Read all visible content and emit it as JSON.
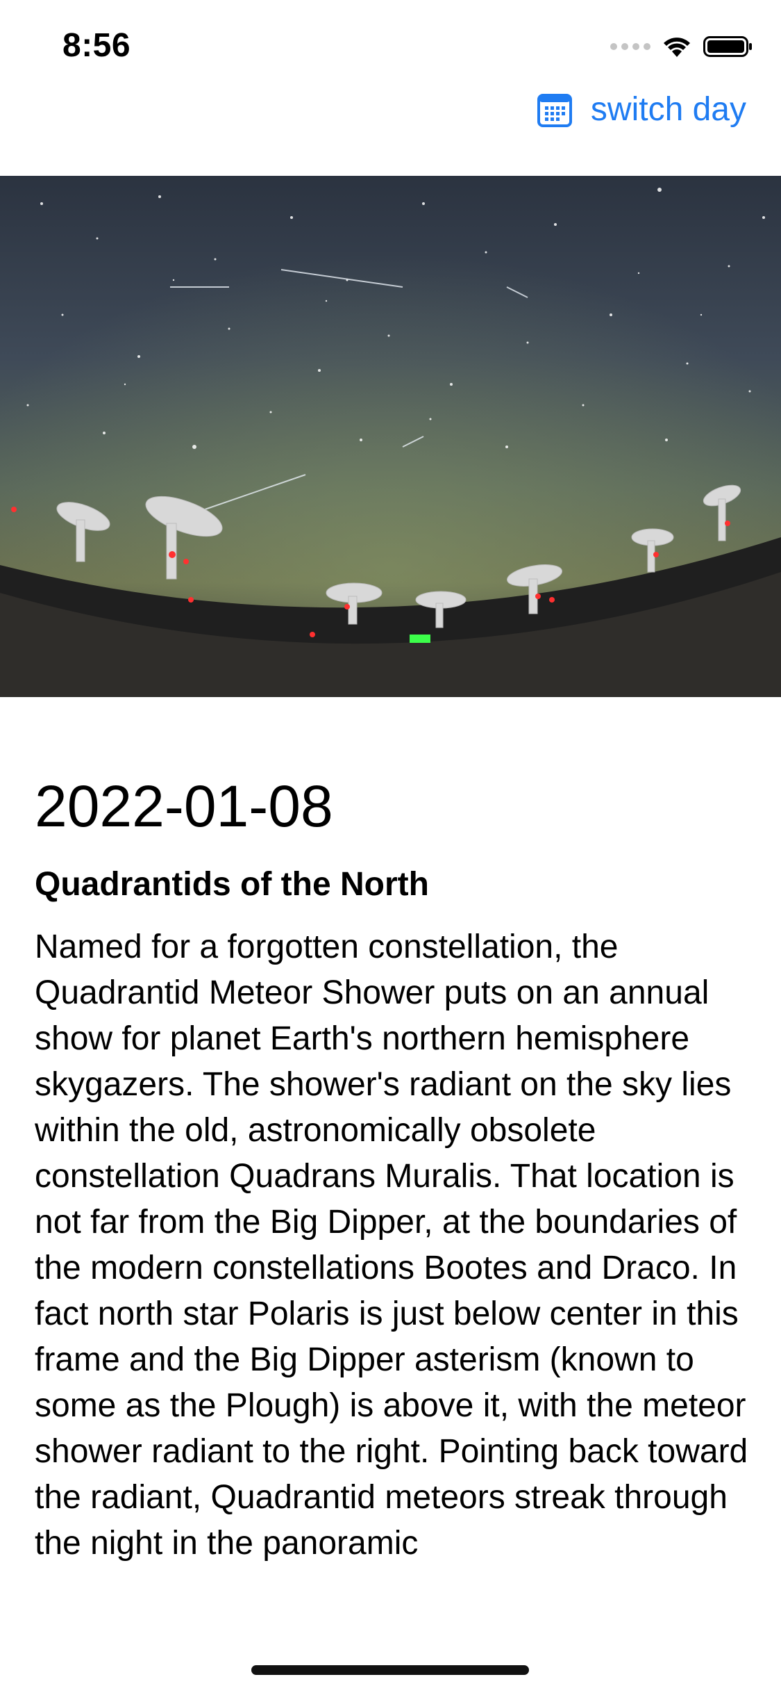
{
  "status_bar": {
    "time": "8:56"
  },
  "nav": {
    "switch_label": "switch day",
    "icon": "calendar-icon",
    "accent_color": "#1f7cf2"
  },
  "hero": {
    "icon": "apod-photo"
  },
  "apod": {
    "date": "2022-01-08",
    "title": "Quadrantids of the North",
    "explanation": "Named for a forgotten constellation, the Quadrantid Meteor Shower puts on an annual show for planet Earth's northern hemisphere skygazers. The shower's radiant on the sky lies within the old, astronomically obsolete constellation Quadrans Muralis. That location is not far from the Big Dipper, at the boundaries of the modern constellations Bootes and Draco. In fact north star Polaris is just below center in this frame and the Big Dipper asterism (known to some as the Plough) is above it, with the meteor shower radiant to the right. Pointing back toward the radiant, Quadrantid meteors streak through the night in the panoramic"
  }
}
